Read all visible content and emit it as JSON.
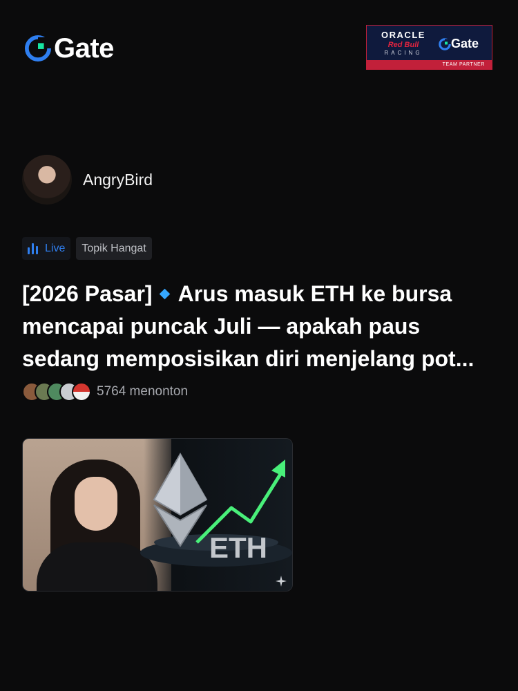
{
  "header": {
    "logo_text": "Gate",
    "partner_badge": {
      "line1": "ORACLE",
      "line2": "Red Bull",
      "line3": "RACING",
      "brand": "Gate",
      "footer": "TEAM PARTNER"
    }
  },
  "author": {
    "name": "AngryBird"
  },
  "tags": {
    "live": "Live",
    "topic": "Topik Hangat"
  },
  "post": {
    "title_prefix": "[2026 Pasar]",
    "title_rest": "Arus masuk ETH ke bursa mencapai puncak Juli — apakah paus sedang memposisikan diri menjelang pot...",
    "viewers": "5764 menonton"
  },
  "thumbnail": {
    "overlay_text": "ETH"
  },
  "colors": {
    "background": "#0b0b0c",
    "accent_blue": "#2f7ff0",
    "brand_green": "#17e5a2",
    "trend_green": "#49f07a"
  }
}
